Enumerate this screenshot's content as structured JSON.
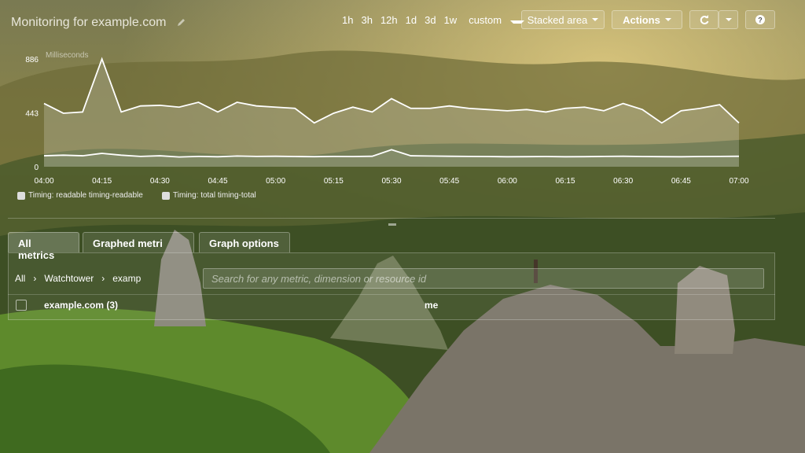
{
  "header": {
    "title": "Monitoring for example.com",
    "ranges": [
      "1h",
      "3h",
      "12h",
      "1d",
      "3d",
      "1w"
    ],
    "custom_label": "custom",
    "graph_type": "Stacked area",
    "actions_label": "Actions",
    "refresh_icon": "refresh-icon",
    "help_icon": "help-icon",
    "edit_icon": "pencil-icon"
  },
  "chart_data": {
    "type": "area",
    "ylabel": "Milliseconds",
    "ytick_labels": [
      "886",
      "443",
      "0"
    ],
    "ylim": [
      0,
      886
    ],
    "x": [
      "04:00",
      "04:05",
      "04:10",
      "04:15",
      "04:20",
      "04:25",
      "04:30",
      "04:35",
      "04:40",
      "04:45",
      "04:50",
      "04:55",
      "05:00",
      "05:05",
      "05:10",
      "05:15",
      "05:20",
      "05:25",
      "05:30",
      "05:35",
      "05:40",
      "05:45",
      "05:50",
      "05:55",
      "06:00",
      "06:05",
      "06:10",
      "06:15",
      "06:20",
      "06:25",
      "06:30",
      "06:35",
      "06:40",
      "06:45",
      "06:50",
      "06:55",
      "07:00"
    ],
    "xtick_labels": [
      "04:00",
      "04:15",
      "04:30",
      "04:45",
      "05:00",
      "05:15",
      "05:30",
      "05:45",
      "06:00",
      "06:15",
      "06:30",
      "06:45",
      "07:00"
    ],
    "series": [
      {
        "name": "Timing: readable timing-readable",
        "values": [
          520,
          440,
          450,
          886,
          450,
          500,
          505,
          490,
          530,
          450,
          530,
          500,
          490,
          480,
          360,
          440,
          490,
          450,
          560,
          480,
          480,
          500,
          480,
          470,
          460,
          470,
          450,
          480,
          490,
          460,
          520,
          470,
          360,
          460,
          480,
          510,
          360
        ]
      },
      {
        "name": "Timing: total timing-total",
        "values": [
          90,
          95,
          90,
          110,
          95,
          85,
          90,
          80,
          85,
          82,
          88,
          85,
          86,
          84,
          83,
          85,
          84,
          86,
          140,
          90,
          88,
          86,
          85,
          84,
          82,
          83,
          84,
          82,
          83,
          85,
          86,
          84,
          83,
          82,
          84,
          85,
          86
        ]
      }
    ],
    "grid": false,
    "legend_position": "bottom-left"
  },
  "tabs": [
    {
      "label": "All metrics",
      "active": true
    },
    {
      "label": "Graphed metri",
      "active": false
    },
    {
      "label": "Graph options",
      "active": false
    }
  ],
  "breadcrumb": [
    "All",
    "Watchtower",
    "examp"
  ],
  "search": {
    "placeholder": "Search for any metric, dimension or resource id"
  },
  "table": {
    "row_label": "example.com (3)",
    "column_fragment": "me"
  }
}
